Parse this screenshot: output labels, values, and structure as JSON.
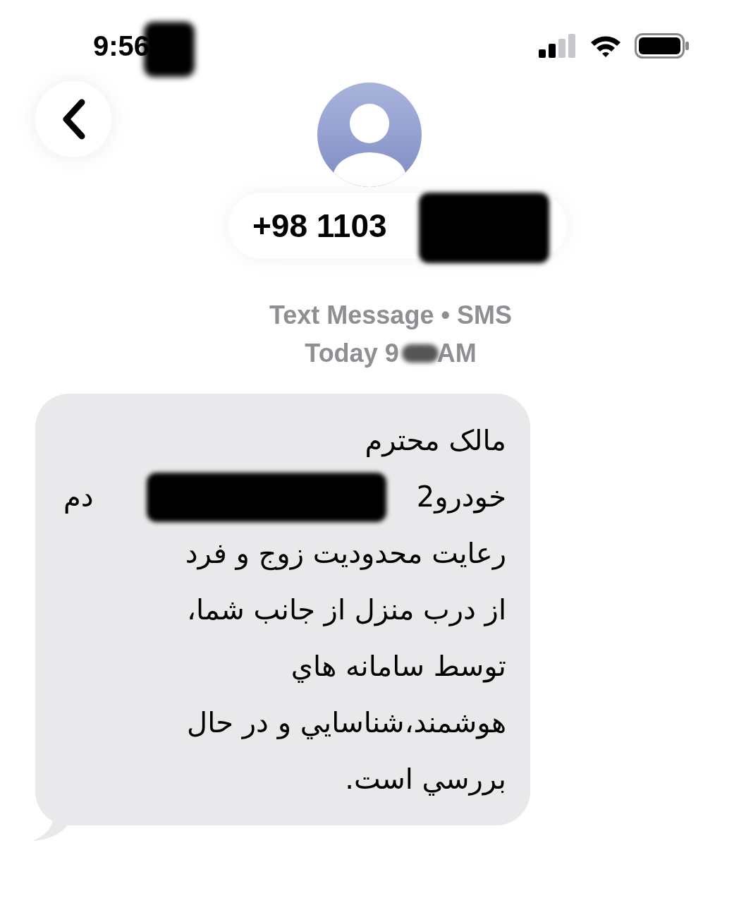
{
  "status_bar": {
    "time": "9:56"
  },
  "contact": {
    "number": "+98 1103"
  },
  "header": {
    "service": "Text Message • SMS",
    "date": "Today 9",
    "time_suffix": "AM"
  },
  "message": {
    "lines": [
      {
        "parts": [
          "مالک محترم"
        ]
      },
      {
        "parts": [
          "خودرو2",
          "دم"
        ]
      },
      {
        "parts": [
          "رعایت محدودیت زوج و فرد"
        ]
      },
      {
        "parts": [
          "از درب منزل از جانب شما،"
        ]
      },
      {
        "parts": [
          "توسط سامانه هاي"
        ]
      },
      {
        "parts": [
          "هوشمند،شناسايي و در حال"
        ]
      },
      {
        "parts": [
          "بررسي است."
        ]
      }
    ]
  }
}
